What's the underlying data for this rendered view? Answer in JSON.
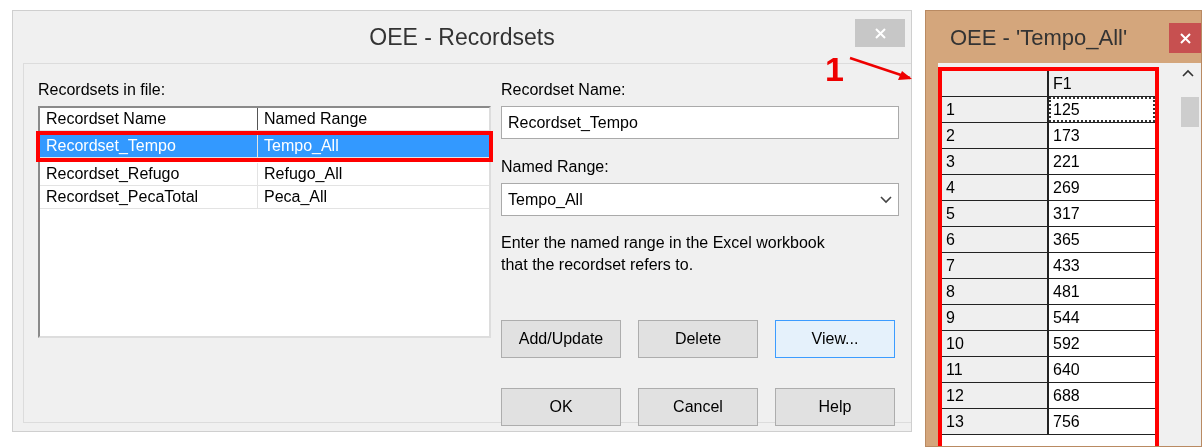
{
  "dialog": {
    "title": "OEE - Recordsets",
    "list_label": "Recordsets in file:",
    "columns": [
      "Recordset Name",
      "Named Range"
    ],
    "rows": [
      {
        "cells": [
          "Recordset_Tempo",
          "Tempo_All"
        ],
        "selected": true,
        "highlighted": true
      },
      {
        "cells": [
          "Recordset_Refugo",
          "Refugo_All"
        ],
        "selected": false,
        "highlighted": false
      },
      {
        "cells": [
          "Recordset_PecaTotal",
          "Peca_All"
        ],
        "selected": false,
        "highlighted": false
      }
    ],
    "name_label": "Recordset Name:",
    "name_value": "Recordset_Tempo",
    "range_label": "Named Range:",
    "range_value": "Tempo_All",
    "help_lines": [
      "Enter the named range in the Excel workbook",
      "that the recordset refers to."
    ],
    "action_buttons": [
      {
        "label": "Add/Update",
        "focused": false
      },
      {
        "label": "Delete",
        "focused": false
      },
      {
        "label": "View...",
        "focused": true
      }
    ],
    "footer_buttons": [
      {
        "label": "OK",
        "focused": false
      },
      {
        "label": "Cancel",
        "focused": false
      },
      {
        "label": "Help",
        "focused": false
      }
    ]
  },
  "annotation": {
    "label": "1"
  },
  "viewer": {
    "title": "OEE - 'Tempo_All'",
    "column": "F1",
    "highlighted": true,
    "rows": [
      {
        "index": "1",
        "value": "125",
        "selected": true
      },
      {
        "index": "2",
        "value": "173",
        "selected": false
      },
      {
        "index": "3",
        "value": "221",
        "selected": false
      },
      {
        "index": "4",
        "value": "269",
        "selected": false
      },
      {
        "index": "5",
        "value": "317",
        "selected": false
      },
      {
        "index": "6",
        "value": "365",
        "selected": false
      },
      {
        "index": "7",
        "value": "433",
        "selected": false
      },
      {
        "index": "8",
        "value": "481",
        "selected": false
      },
      {
        "index": "9",
        "value": "544",
        "selected": false
      },
      {
        "index": "10",
        "value": "592",
        "selected": false
      },
      {
        "index": "11",
        "value": "640",
        "selected": false
      },
      {
        "index": "12",
        "value": "688",
        "selected": false
      },
      {
        "index": "13",
        "value": "756",
        "selected": false
      }
    ]
  }
}
